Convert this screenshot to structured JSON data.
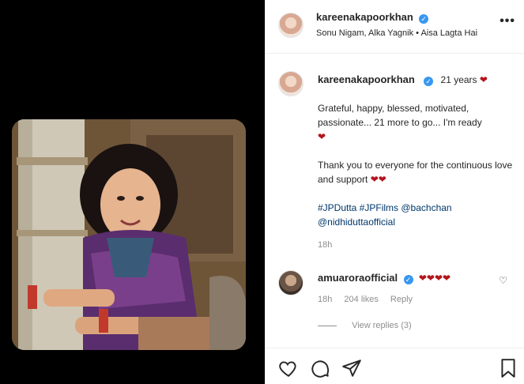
{
  "post": {
    "author": "kareenakapoorkhan",
    "song": "Sonu Nigam, Alka Yagnik • Aisa Lagta Hai",
    "more": "•••"
  },
  "caption": {
    "author": "kareenakapoorkhan",
    "headline": "21 years",
    "line1": "Grateful, happy, blessed, motivated, passionate... 21 more to go... I'm ready",
    "line2": "Thank you to everyone for the continuous love and support",
    "tags": "#JPDutta #JPFilms @bachchan @nidhiduttaofficial",
    "time": "18h"
  },
  "comment": {
    "author": "amuaroraofficial",
    "hearts": "❤❤❤❤",
    "time": "18h",
    "likes": "204 likes",
    "reply": "Reply",
    "view_replies": "View replies (3)"
  },
  "icons": {
    "heart_inline": "❤",
    "verified": "✓",
    "like_small": "♡"
  }
}
